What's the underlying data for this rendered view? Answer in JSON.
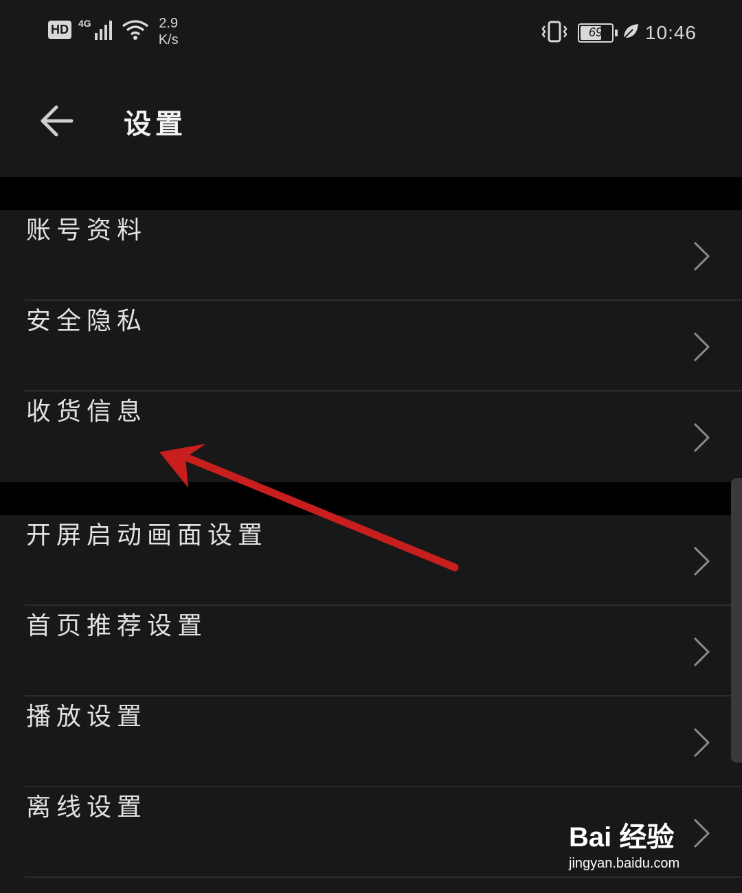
{
  "status_bar": {
    "hd": "HD",
    "network": "4G",
    "speed_value": "2.9",
    "speed_unit": "K/s",
    "battery": "69",
    "battery_level": 0.69,
    "time": "10:46",
    "icons": [
      "vibrate-icon",
      "signal-icon",
      "wifi-icon",
      "battery-icon",
      "eco-leaf-icon"
    ]
  },
  "header": {
    "title": "设置",
    "back_icon": "back-arrow-icon"
  },
  "groups": [
    {
      "items": [
        {
          "label": "账号资料"
        },
        {
          "label": "安全隐私"
        },
        {
          "label": "收货信息"
        }
      ]
    },
    {
      "items": [
        {
          "label": "开屏启动画面设置"
        },
        {
          "label": "首页推荐设置"
        },
        {
          "label": "播放设置"
        },
        {
          "label": "离线设置"
        }
      ]
    }
  ],
  "annotation": {
    "arrow_color": "#c81e1e"
  },
  "watermark": {
    "logo": "Bai 经验",
    "url": "jingyan.baidu.com"
  },
  "colors": {
    "background": "#181818",
    "separator": "#000000",
    "text": "#e2e2e2"
  }
}
